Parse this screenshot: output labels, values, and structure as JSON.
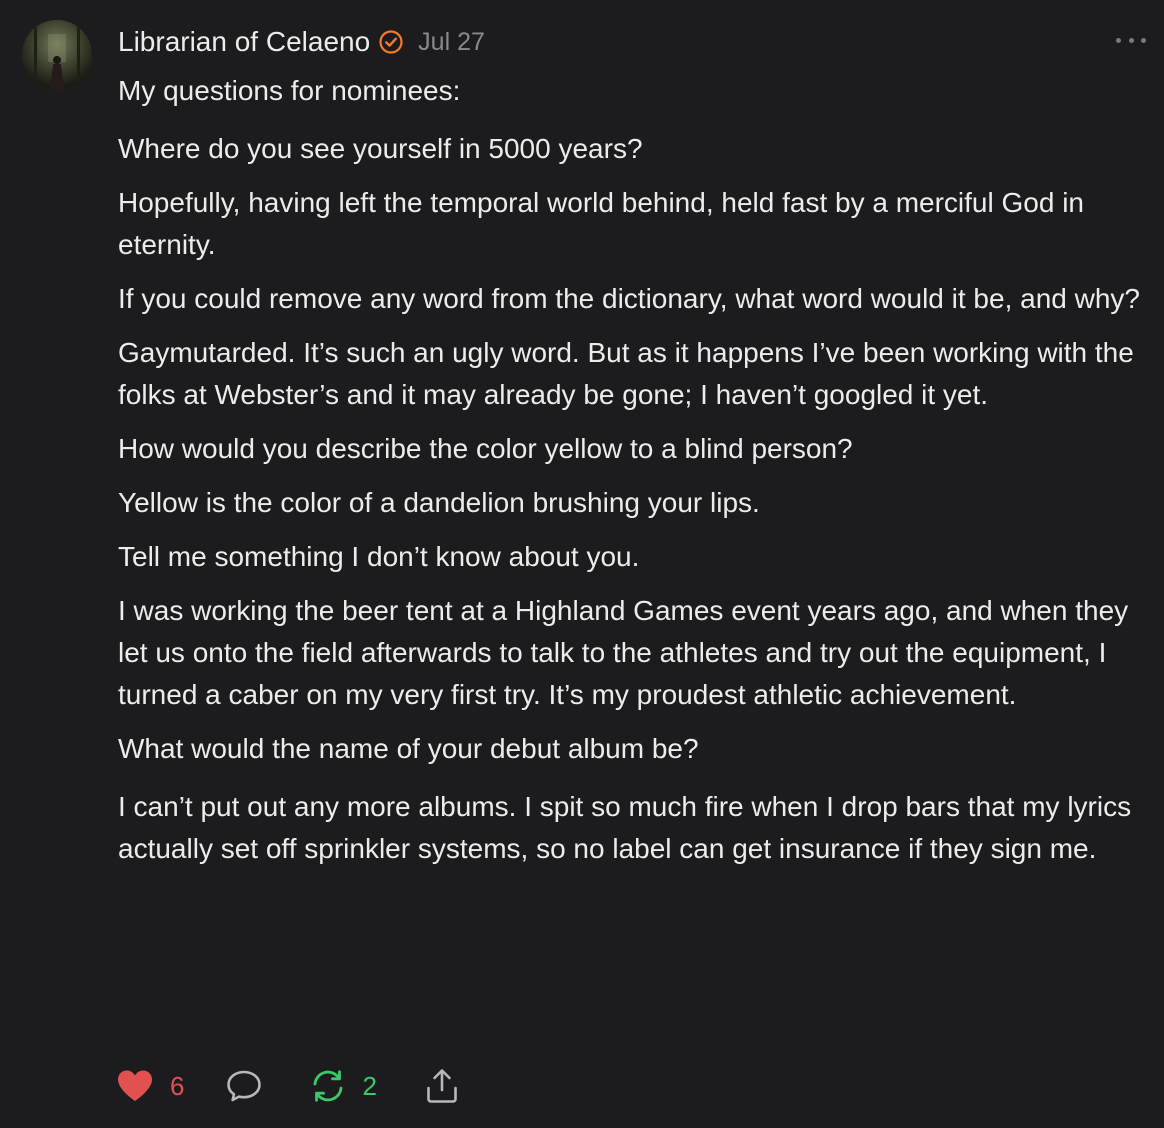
{
  "post": {
    "author": "Librarian of Celaeno",
    "date": "Jul 27",
    "paragraphs": [
      "My questions for nominees:",
      "Where do you see yourself in 5000 years?",
      "Hopefully, having left the temporal world behind, held fast by a merciful God in eternity.",
      "If you could remove any word from the dictionary, what word would it be, and why?",
      "Gaymutarded. It’s such an ugly word. But as it happens I’ve been working with the folks at Webster’s and it may already be gone; I haven’t googled it yet.",
      "How would you describe the color yellow to a blind person?",
      "Yellow is the color of a dandelion brushing your lips.",
      "Tell me something I don’t know about you.",
      "I was working the beer tent at a Highland Games event years ago, and when they let us onto the field afterwards to talk to the athletes and try out the equipment, I turned a caber on my very first try. It’s my proudest athletic achievement.",
      "What would the name of your debut album be?",
      "I can’t put out any more albums. I spit so much fire when I drop bars that my lyrics actually set off sprinkler systems, so no label can get insurance if they sign me."
    ]
  },
  "actions": {
    "likes": "6",
    "reposts": "2"
  },
  "icons": {
    "verified": "verified-check-icon",
    "more": "more-options-icon",
    "like": "heart-icon",
    "comment": "comment-bubble-icon",
    "repost": "repost-icon",
    "share": "share-icon"
  },
  "colors": {
    "background": "#1c1c1e",
    "text": "#ececec",
    "muted": "#8a8a8e",
    "verified": "#f07b2b",
    "like": "#e0524f",
    "repost": "#3ec86a"
  }
}
